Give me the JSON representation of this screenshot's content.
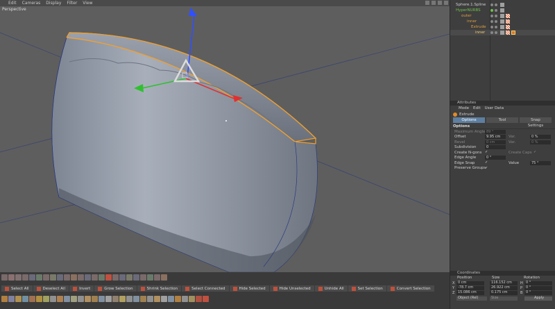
{
  "viewport": {
    "menu": [
      "Edit",
      "Cameras",
      "Display",
      "Filter",
      "View"
    ],
    "label": "Perspective"
  },
  "object_manager": {
    "objects": [
      {
        "name": "Sphere.1.Spline",
        "color": "#cfcfcf"
      },
      {
        "name": "HyperNURBS",
        "color": "#6fc04a"
      },
      {
        "name": "outer",
        "color": "#e0a040"
      },
      {
        "name": "inner",
        "color": "#e0a040"
      },
      {
        "name": "Extrude",
        "color": "#e0a040"
      },
      {
        "name": "inner",
        "color": "#ffd070"
      }
    ]
  },
  "attributes": {
    "title": "Attributes",
    "menu": [
      "Mode",
      "Edit",
      "User Data"
    ],
    "object_name": "Extrude",
    "tabs": [
      "Options",
      "Tool",
      "Snap Settings"
    ],
    "section": "Options",
    "rows": {
      "maximum_angle": {
        "label": "Maximum Angle",
        "value": "89 °"
      },
      "offset": {
        "label": "Offset",
        "value": "9.95 cm",
        "var_label": "Var.",
        "var_value": "0 %"
      },
      "bevel": {
        "label": "Bevel",
        "value": "0 cm",
        "var_label": "Var.",
        "var_value": "0 %"
      },
      "subdivision": {
        "label": "Subdivision",
        "value": "0"
      },
      "create_ngons": {
        "label": "Create N-gons",
        "check": "✓",
        "caps_label": "Create Caps",
        "caps_check": "✓"
      },
      "edge_angle": {
        "label": "Edge Angle",
        "value": "0 °"
      },
      "edge_snap": {
        "label": "Edge Snap",
        "check": "✓",
        "value_label": "Value",
        "value": "75 °"
      },
      "preserve_groups": {
        "label": "Preserve Groups",
        "check": "✓"
      }
    }
  },
  "coordinates": {
    "title": "Coordinates",
    "headers": {
      "position": "Position",
      "size": "Size",
      "rotation": "Rotation"
    },
    "rows": [
      {
        "axis": "X",
        "pos": "0 cm",
        "size": "116.152 cm",
        "rot_axis": "H",
        "rot": "0 °"
      },
      {
        "axis": "Y",
        "pos": "-78.7 cm",
        "size": "26.922 cm",
        "rot_axis": "P",
        "rot": "0 °"
      },
      {
        "axis": "Z",
        "pos": "15.086 cm",
        "size": "0.175 cm",
        "rot_axis": "B",
        "rot": "0 °"
      }
    ],
    "mode": "Object (Rel)",
    "size_mode": "Size",
    "apply": "Apply"
  },
  "commands": [
    "Select All",
    "Deselect All",
    "Invert",
    "Grow Selection",
    "Shrink Selection",
    "Select Connected",
    "Hide Selected",
    "Hide Unselected",
    "Unhide All",
    "Set Selection",
    "Convert Selection"
  ],
  "colors": {
    "viewport_bg": "#5e5e5e",
    "panel_bg": "#3e3e3e",
    "selection_orange": "#f0a030",
    "active_tab": "#5e7fa0"
  }
}
